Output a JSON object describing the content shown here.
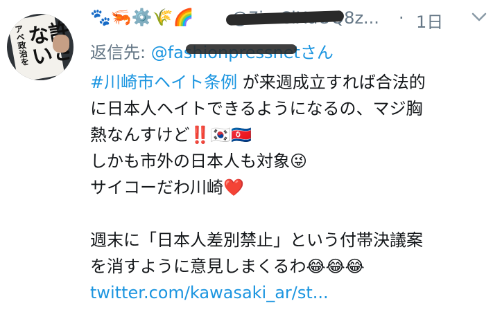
{
  "author": {
    "emoji_name": "🐾🦐⚙️🌾🌈",
    "handle": "@7imCiXuOQ8z...",
    "avatar_sign_small": "アベ政治を",
    "avatar_sign_big": "許さない"
  },
  "meta": {
    "separator": "·",
    "timestamp": "1日"
  },
  "reply": {
    "prefix": "返信先: ",
    "mention_start": "@f",
    "mention_end": "さん",
    "mention_hidden": "ashionpressnet"
  },
  "tweet": {
    "hashtag": "#川崎市ヘイト条例",
    "line1_rest": " が来週成立すれば合法的",
    "line2": "に日本人ヘイトできるようになるの、マジ胸",
    "line3_text": "熱なんすけど",
    "line3_emojis": "‼️🇰🇷🇰🇵",
    "line4_text": "しかも市外の日本人も対象",
    "line4_emoji": "😜",
    "line5_text": "サイコーだわ川崎",
    "line5_emoji": "❤️",
    "line6": "週末に「日本人差別禁止」という付帯決議案",
    "line7_text": "を消すように意見しまくるわ",
    "line7_emojis": "😂😂😂",
    "link": "twitter.com/kawasaki_ar/st..."
  },
  "icons": {
    "caret": "chevron-down-icon"
  },
  "colors": {
    "link": "#1b95e0",
    "secondary_text": "#657786",
    "primary_text": "#14171a"
  }
}
